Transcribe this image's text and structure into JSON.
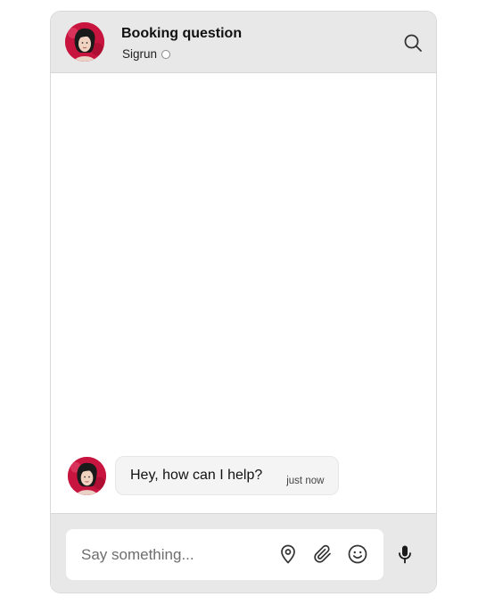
{
  "header": {
    "title": "Booking question",
    "agent_name": "Sigrun",
    "status": "offline",
    "icons": {
      "avatar": "agent-avatar",
      "search": "search-icon"
    }
  },
  "messages": [
    {
      "sender": "Sigrun",
      "text": "Hey, how can I help?",
      "time": "just now"
    }
  ],
  "composer": {
    "placeholder": "Say something...",
    "value": "",
    "icons": [
      "location-pin-icon",
      "paperclip-icon",
      "smiley-icon",
      "microphone-icon"
    ]
  },
  "colors": {
    "header_bg": "#e8e8e8",
    "bubble_bg": "#f4f4f4",
    "avatar_bg": "#c8153f"
  }
}
